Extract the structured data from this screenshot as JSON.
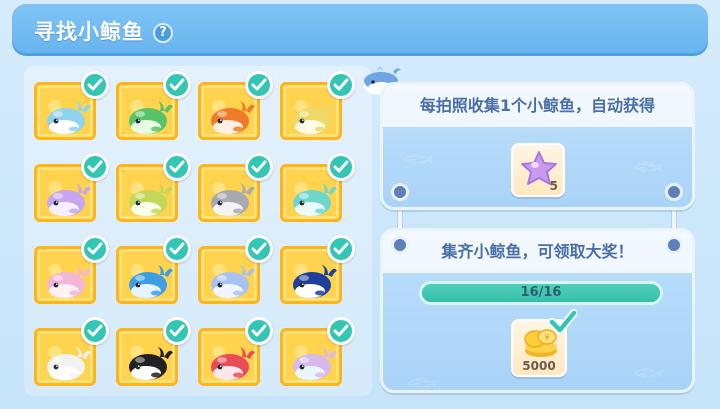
{
  "header": {
    "title": "寻找小鲸鱼",
    "help_label": "?"
  },
  "collection": {
    "slots": [
      {
        "whale_color": "#8fd3f0",
        "belly": "#ffffff",
        "collected": true
      },
      {
        "whale_color": "#59c36a",
        "belly": "#e8fbe3",
        "collected": true
      },
      {
        "whale_color": "#f07a2a",
        "belly": "#fff1e2",
        "collected": true
      },
      {
        "whale_color": "#ecd96a",
        "belly": "#fffbe6",
        "collected": true
      },
      {
        "whale_color": "#c6a6ef",
        "belly": "#f6efff",
        "collected": true
      },
      {
        "whale_color": "#c2d85a",
        "belly": "#fafde8",
        "collected": true
      },
      {
        "whale_color": "#a7abb0",
        "belly": "#f3f3f3",
        "collected": true
      },
      {
        "whale_color": "#6fd6cd",
        "belly": "#eafcfa",
        "collected": true
      },
      {
        "whale_color": "#f2b6d6",
        "belly": "#fff1f8",
        "collected": true
      },
      {
        "whale_color": "#3d9ee6",
        "belly": "#e6f4ff",
        "collected": true
      },
      {
        "whale_color": "#a7c2f2",
        "belly": "#f0f5ff",
        "collected": true
      },
      {
        "whale_color": "#1f3f9c",
        "belly": "#ffffff",
        "collected": true
      },
      {
        "whale_color": "#f2f2f2",
        "belly": "#ffffff",
        "collected": true
      },
      {
        "whale_color": "#222222",
        "belly": "#ffffff",
        "collected": true
      },
      {
        "whale_color": "#e84c58",
        "belly": "#ffe8ea",
        "collected": true
      },
      {
        "whale_color": "#d7b8ef",
        "belly": "#e8f7ff",
        "collected": true
      }
    ]
  },
  "photo_reward": {
    "heading": "每拍照收集1个小鲸鱼，自动获得",
    "item_icon": "purple-star-icon",
    "quantity": "5"
  },
  "grand_prize": {
    "heading": "集齐小鲸鱼，可领取大奖！",
    "progress_text": "16/16",
    "progress_fraction": 1.0,
    "item_icon": "gold-coins-icon",
    "quantity": "5000",
    "claimed": true
  },
  "colors": {
    "accent_teal": "#33c6b4",
    "title_blue": "#67b4ef",
    "slot_gold": "#ffcf3f"
  }
}
